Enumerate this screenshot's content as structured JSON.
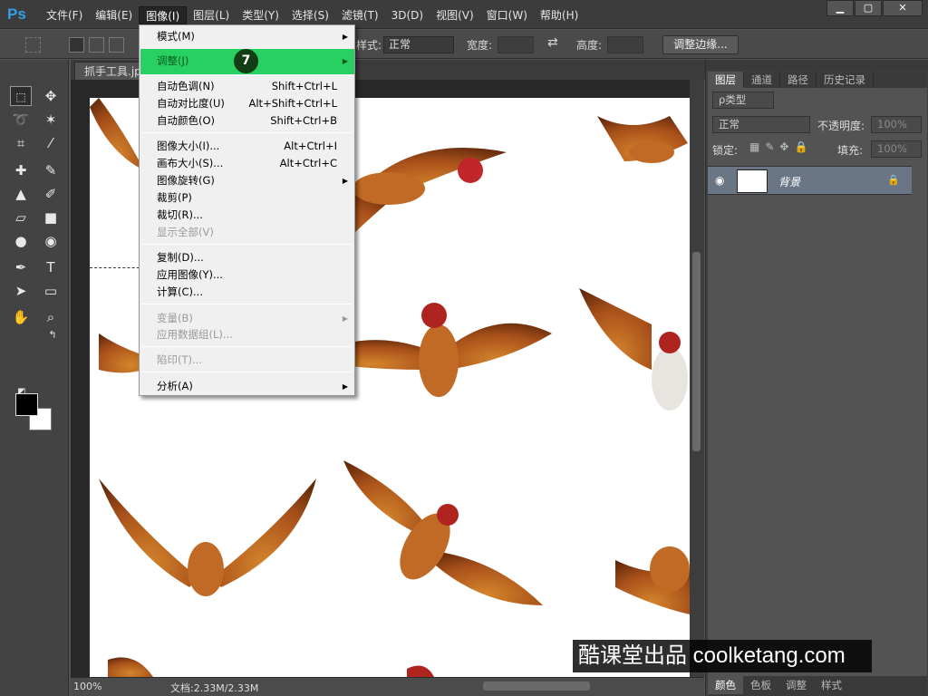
{
  "app": {
    "logo": "Ps"
  },
  "menubar": [
    "文件(F)",
    "编辑(E)",
    "图像(I)",
    "图层(L)",
    "类型(Y)",
    "选择(S)",
    "滤镜(T)",
    "3D(D)",
    "视图(V)",
    "窗口(W)",
    "帮助(H)"
  ],
  "window_controls": {
    "minimize": "▁",
    "maximize": "▢",
    "close": "✕"
  },
  "options_bar": {
    "style_label": "样式:",
    "style_value": "正常",
    "width_label": "宽度:",
    "height_label": "高度:",
    "refine_edge_button": "调整边缘..."
  },
  "document": {
    "tab_label": "抓手工具.jp"
  },
  "status": {
    "zoom": "100%",
    "doc_info": "文档:2.33M/2.33M"
  },
  "image_menu": {
    "items": [
      {
        "label": "模式(M)",
        "shortcut": "",
        "submenu": true,
        "disabled": false
      },
      {
        "label": "调整(J)",
        "shortcut": "",
        "submenu": true,
        "disabled": false,
        "highlighted": true
      },
      {
        "label": "自动色调(N)",
        "shortcut": "Shift+Ctrl+L",
        "submenu": false,
        "disabled": false
      },
      {
        "label": "自动对比度(U)",
        "shortcut": "Alt+Shift+Ctrl+L",
        "submenu": false,
        "disabled": false
      },
      {
        "label": "自动颜色(O)",
        "shortcut": "Shift+Ctrl+B",
        "submenu": false,
        "disabled": false
      },
      {
        "label": "图像大小(I)...",
        "shortcut": "Alt+Ctrl+I",
        "submenu": false,
        "disabled": false
      },
      {
        "label": "画布大小(S)...",
        "shortcut": "Alt+Ctrl+C",
        "submenu": false,
        "disabled": false
      },
      {
        "label": "图像旋转(G)",
        "shortcut": "",
        "submenu": true,
        "disabled": false
      },
      {
        "label": "裁剪(P)",
        "shortcut": "",
        "submenu": false,
        "disabled": false
      },
      {
        "label": "裁切(R)...",
        "shortcut": "",
        "submenu": false,
        "disabled": false
      },
      {
        "label": "显示全部(V)",
        "shortcut": "",
        "submenu": false,
        "disabled": true
      },
      {
        "label": "复制(D)...",
        "shortcut": "",
        "submenu": false,
        "disabled": false
      },
      {
        "label": "应用图像(Y)...",
        "shortcut": "",
        "submenu": false,
        "disabled": false
      },
      {
        "label": "计算(C)...",
        "shortcut": "",
        "submenu": false,
        "disabled": false
      },
      {
        "label": "变量(B)",
        "shortcut": "",
        "submenu": true,
        "disabled": true
      },
      {
        "label": "应用数据组(L)...",
        "shortcut": "",
        "submenu": false,
        "disabled": true
      },
      {
        "label": "陷印(T)...",
        "shortcut": "",
        "submenu": false,
        "disabled": true
      },
      {
        "label": "分析(A)",
        "shortcut": "",
        "submenu": true,
        "disabled": false
      }
    ]
  },
  "step_badge": "7",
  "layers_panel": {
    "tabs": [
      "图层",
      "通道",
      "路径",
      "历史记录"
    ],
    "kind_filter": "ρ类型",
    "blend_mode": "正常",
    "opacity_label": "不透明度:",
    "opacity_value": "100%",
    "lock_label": "锁定:",
    "fill_label": "填充:",
    "fill_value": "100%",
    "layer_name": "背景"
  },
  "bottom_tabs": [
    "颜色",
    "色板",
    "调整",
    "样式"
  ],
  "watermark": "酷课堂出品 coolketang.com",
  "colors": {
    "highlight": "#27d060",
    "badge": "#123d15"
  }
}
